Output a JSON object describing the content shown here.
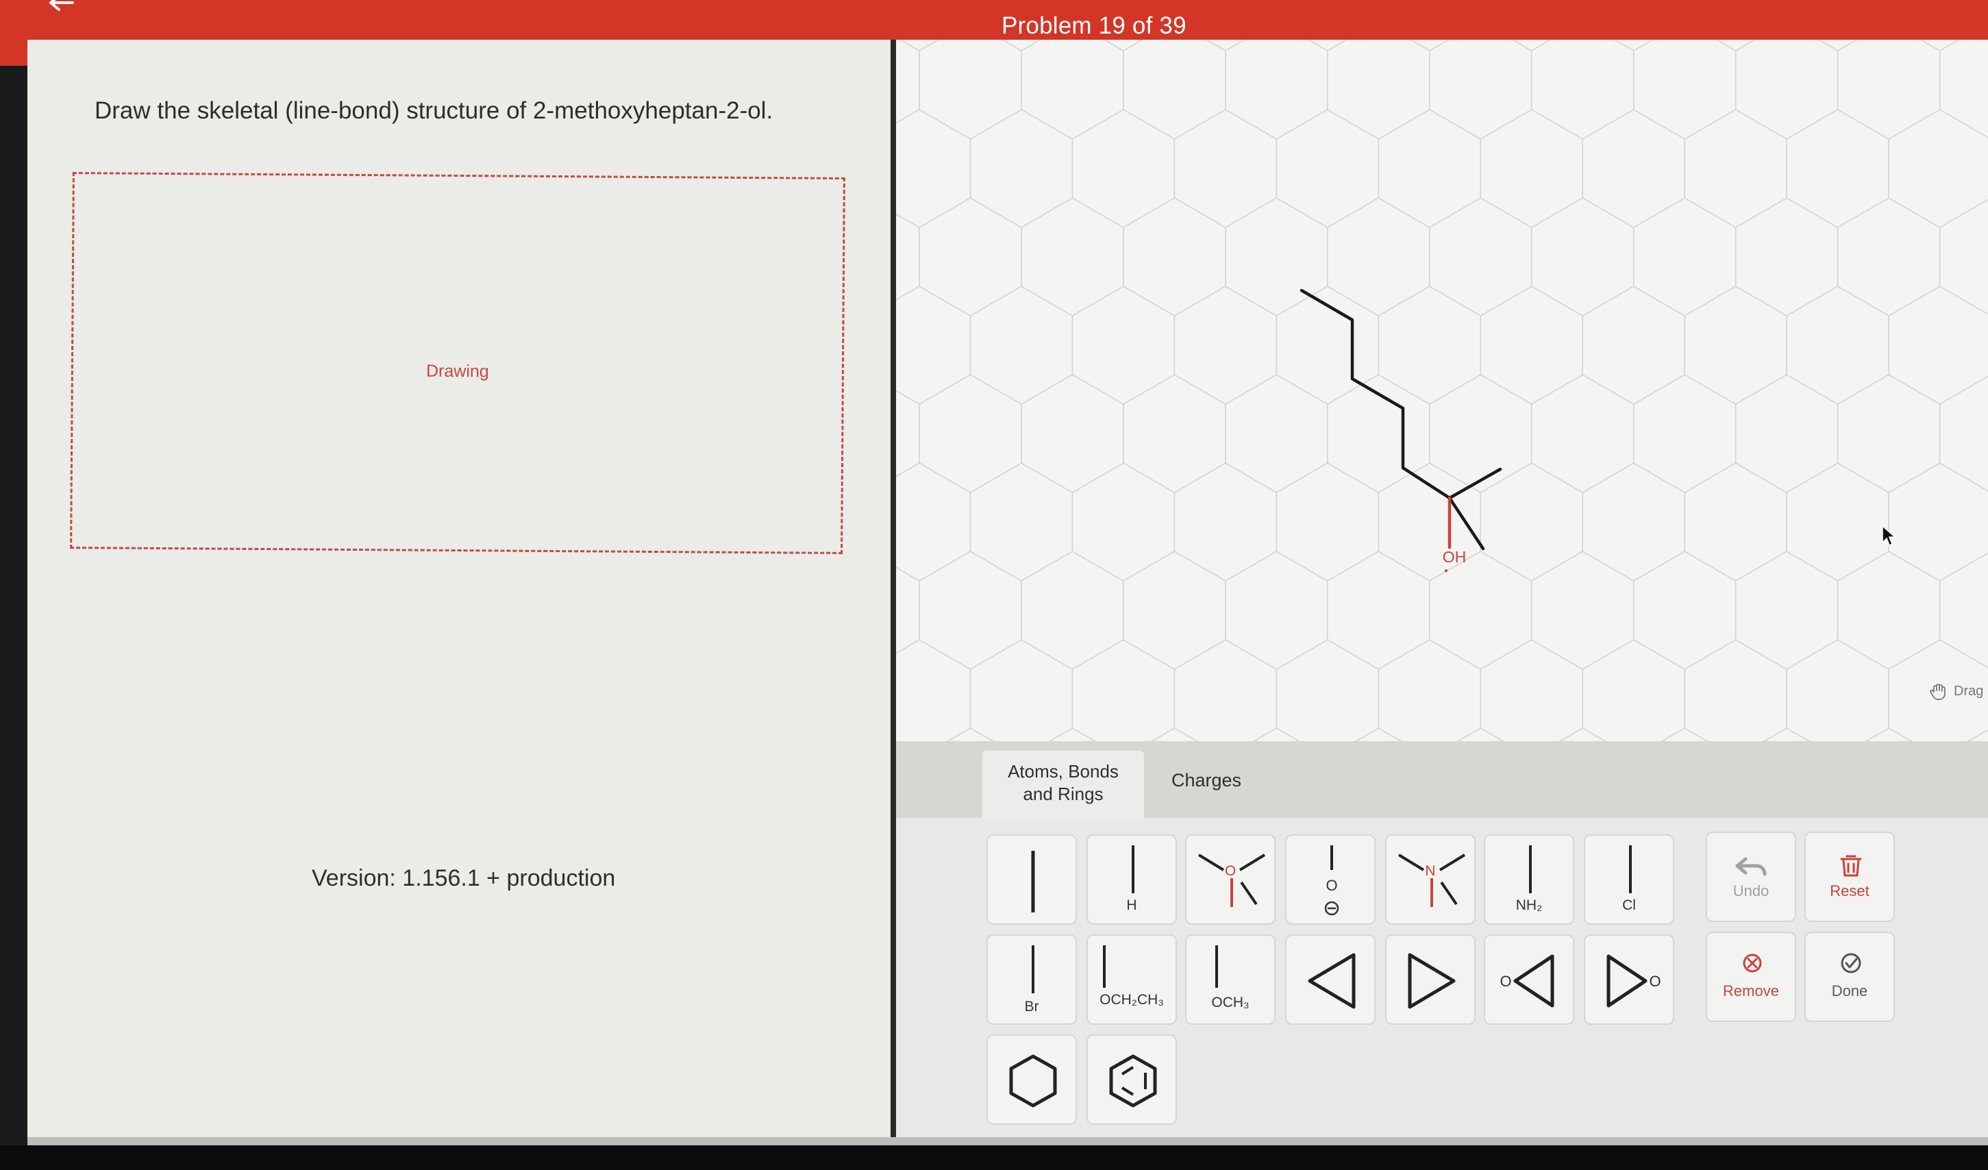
{
  "header": {
    "title": "Problem 19 of 39",
    "back_icon": "back-arrow-icon"
  },
  "question": {
    "text": "Draw the skeletal (line-bond) structure of 2-methoxyheptan-2-ol.",
    "drawing_label": "Drawing",
    "version": "Version: 1.156.1 + production"
  },
  "canvas": {
    "atom_label": "OH",
    "drag_label": "Drag",
    "drag_icon": "hand-icon"
  },
  "tabs": {
    "atoms_bonds_rings": [
      "Atoms, Bonds",
      "and Rings"
    ],
    "charges": "Charges"
  },
  "toolbar": {
    "single_bond": "",
    "h": "H",
    "o": "O",
    "n": "N",
    "nh2": "NH₂",
    "cl": "Cl",
    "br": "Br",
    "och2ch3": "OCH₂CH₃",
    "och3": "OCH₃",
    "undo": "Undo",
    "reset": "Reset",
    "remove": "Remove",
    "done": "Done"
  },
  "colors": {
    "header_red": "#d33526",
    "accent_red": "#c8433c",
    "panel_bg": "#ebebe7",
    "bond_black": "#1a1a1a"
  }
}
